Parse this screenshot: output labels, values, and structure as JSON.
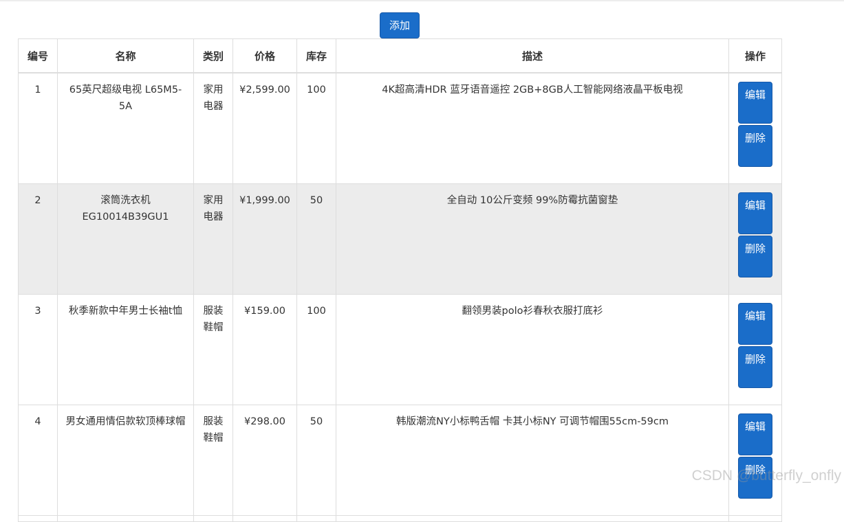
{
  "toolbar": {
    "add_label": "添加"
  },
  "table": {
    "headers": [
      "编号",
      "名称",
      "类别",
      "价格",
      "库存",
      "描述",
      "操作"
    ],
    "rows": [
      {
        "id": "1",
        "name": "65英尺超级电视 L65M5-5A",
        "category": "家用电器",
        "price": "¥2,599.00",
        "stock": "100",
        "desc": "4K超高清HDR 蓝牙语音遥控 2GB+8GB人工智能网络液晶平板电视",
        "edit": "编辑",
        "delete": "删除"
      },
      {
        "id": "2",
        "name": "滚筒洗衣机 EG10014B39GU1",
        "category": "家用电器",
        "price": "¥1,999.00",
        "stock": "50",
        "desc": "全自动 10公斤变频 99%防霉抗菌窗垫",
        "edit": "编辑",
        "delete": "删除"
      },
      {
        "id": "3",
        "name": "秋季新款中年男士长袖t恤",
        "category": "服装鞋帽",
        "price": "¥159.00",
        "stock": "100",
        "desc": "翻领男装polo衫春秋衣服打底衫",
        "edit": "编辑",
        "delete": "删除"
      },
      {
        "id": "4",
        "name": "男女通用情侣款软顶棒球帽",
        "category": "服装鞋帽",
        "price": "¥298.00",
        "stock": "50",
        "desc": "韩版潮流NY小标鸭舌帽 卡其小标NY 可调节帽围55cm-59cm",
        "edit": "编辑",
        "delete": "删除"
      }
    ]
  },
  "watermark": "CSDN @butterfly_onfly"
}
